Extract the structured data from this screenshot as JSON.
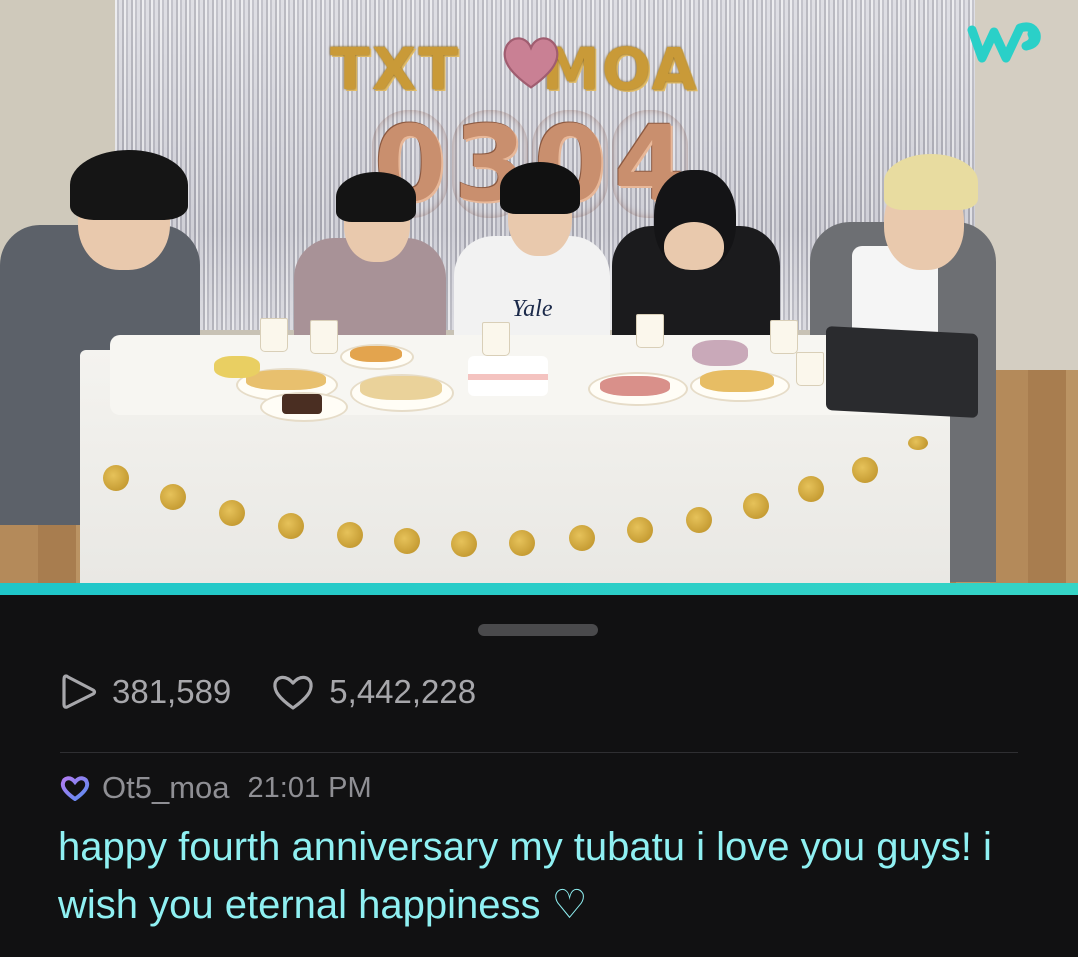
{
  "app": {
    "brand_icon": "weverse-logo-icon",
    "accent_color": "#1fc6c9"
  },
  "video": {
    "banner_letters": [
      "TXT",
      "MOA"
    ],
    "banner_numbers": [
      "0",
      "3",
      "0",
      "4"
    ],
    "shirt_text": "Yale",
    "progress_color": "#1fc6c9"
  },
  "stats": {
    "views_icon": "play-icon",
    "views": "381,589",
    "likes_icon": "heart-icon",
    "likes": "5,442,228"
  },
  "comment": {
    "badge_icon": "membership-heart-icon",
    "username": "Ot5_moa",
    "time": "21:01 PM",
    "text": "happy fourth anniversary my tubatu i love you guys! i wish you eternal happiness ♡",
    "text_color": "#8ff0f2"
  }
}
